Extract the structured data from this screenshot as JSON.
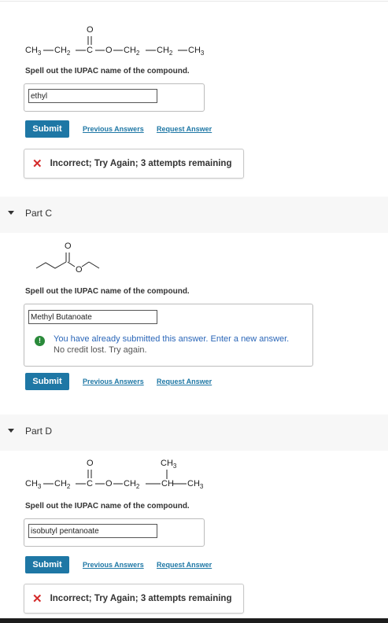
{
  "part_b": {
    "formula": {
      "ch3a": "CH",
      "sub3a": "3",
      "ch2a": "CH",
      "sub2a": "2",
      "o_top": "O",
      "c": "C",
      "o_mid": "O",
      "ch2b": "CH",
      "sub2b": "2",
      "ch2c": "CH",
      "sub2c": "2",
      "ch3b": "CH",
      "sub3b": "3"
    },
    "prompt": "Spell out the IUPAC name of the compound.",
    "answer": "ethyl",
    "submit_label": "Submit",
    "previous_answers": "Previous Answers",
    "request_answer": "Request Answer",
    "feedback": "Incorrect; Try Again; 3 attempts remaining"
  },
  "part_c": {
    "title": "Part C",
    "skeletal_o_top": "O",
    "skeletal_o_mid": "O",
    "prompt": "Spell out the IUPAC name of the compound.",
    "answer": "Methyl Butanoate",
    "notice_line1": "You have already submitted this answer. Enter a new answer.",
    "notice_line2": "No credit lost. Try again.",
    "submit_label": "Submit",
    "previous_answers": "Previous Answers",
    "request_answer": "Request Answer"
  },
  "part_d": {
    "title": "Part D",
    "formula": {
      "o_top": "O",
      "ch3_top": "CH",
      "sub3_top": "3",
      "ch3a": "CH",
      "sub3a": "3",
      "ch2a": "CH",
      "sub2a": "2",
      "c": "C",
      "o_mid": "O",
      "ch2b": "CH",
      "sub2b": "2",
      "ch": "CH",
      "ch3b": "CH",
      "sub3b": "3"
    },
    "prompt": "Spell out the IUPAC name of the compound.",
    "answer": "isobutyl pentanoate",
    "submit_label": "Submit",
    "previous_answers": "Previous Answers",
    "request_answer": "Request Answer",
    "feedback": "Incorrect; Try Again; 3 attempts remaining"
  },
  "colors": {
    "accent": "#1e77a5",
    "error": "#d42a2a",
    "info": "#2a8a3a",
    "info_text": "#2a66b8"
  },
  "icons": [
    "caret-down-icon",
    "close-x-icon",
    "info-icon"
  ]
}
